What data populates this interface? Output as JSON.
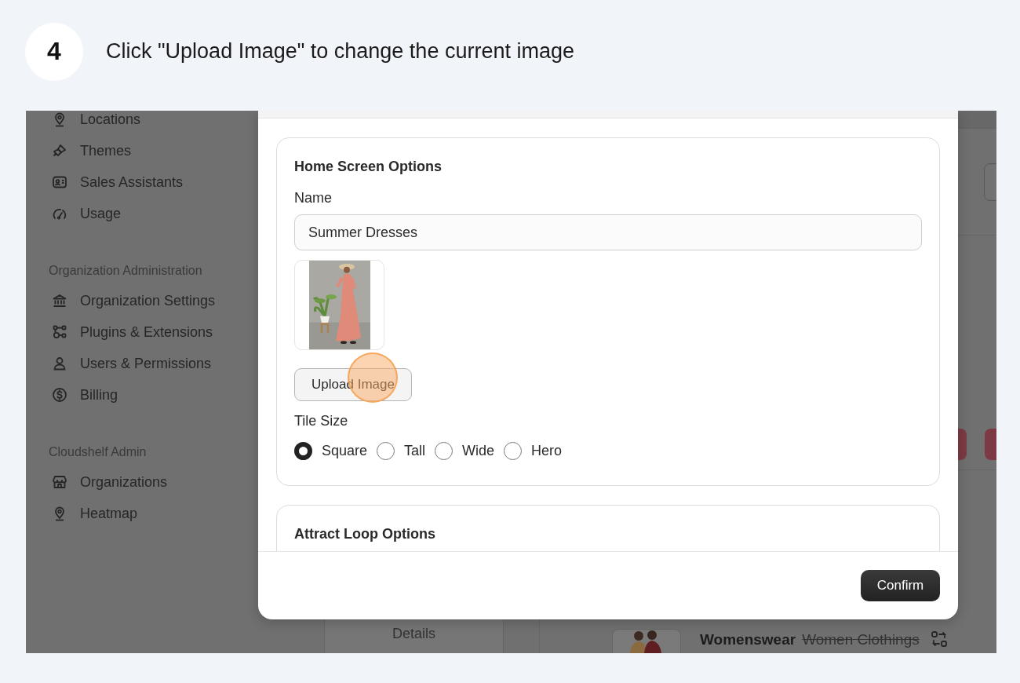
{
  "step": {
    "number": "4",
    "instruction": "Click \"Upload Image\" to change the current image"
  },
  "sidebar": {
    "sections": [
      {
        "items": [
          {
            "label": "Locations",
            "kind": "pin"
          },
          {
            "label": "Themes",
            "kind": "brush"
          },
          {
            "label": "Sales Assistants",
            "kind": "card"
          },
          {
            "label": "Usage",
            "kind": "gauge"
          }
        ]
      },
      {
        "title": "Organization Administration",
        "items": [
          {
            "label": "Organization Settings",
            "kind": "bank"
          },
          {
            "label": "Plugins & Extensions",
            "kind": "nodes"
          },
          {
            "label": "Users & Permissions",
            "kind": "user"
          },
          {
            "label": "Billing",
            "kind": "dollar"
          }
        ]
      },
      {
        "title": "Cloudshelf Admin",
        "items": [
          {
            "label": "Organizations",
            "kind": "store"
          },
          {
            "label": "Heatmap",
            "kind": "pin"
          }
        ]
      }
    ]
  },
  "dialog": {
    "home_screen_options": {
      "title": "Home Screen Options",
      "name_label": "Name",
      "name_value": "Summer Dresses",
      "upload_button": "Upload Image",
      "tile_size_label": "Tile Size",
      "tile_sizes": [
        {
          "label": "Square",
          "selected": true
        },
        {
          "label": "Tall",
          "selected": false
        },
        {
          "label": "Wide",
          "selected": false
        },
        {
          "label": "Hero",
          "selected": false
        }
      ]
    },
    "attract_loop_options": {
      "title": "Attract Loop Options"
    },
    "confirm_button": "Confirm"
  },
  "background": {
    "details_label": "Details",
    "product": {
      "name": "Womenswear",
      "old_name": "Women Clothings"
    }
  }
}
